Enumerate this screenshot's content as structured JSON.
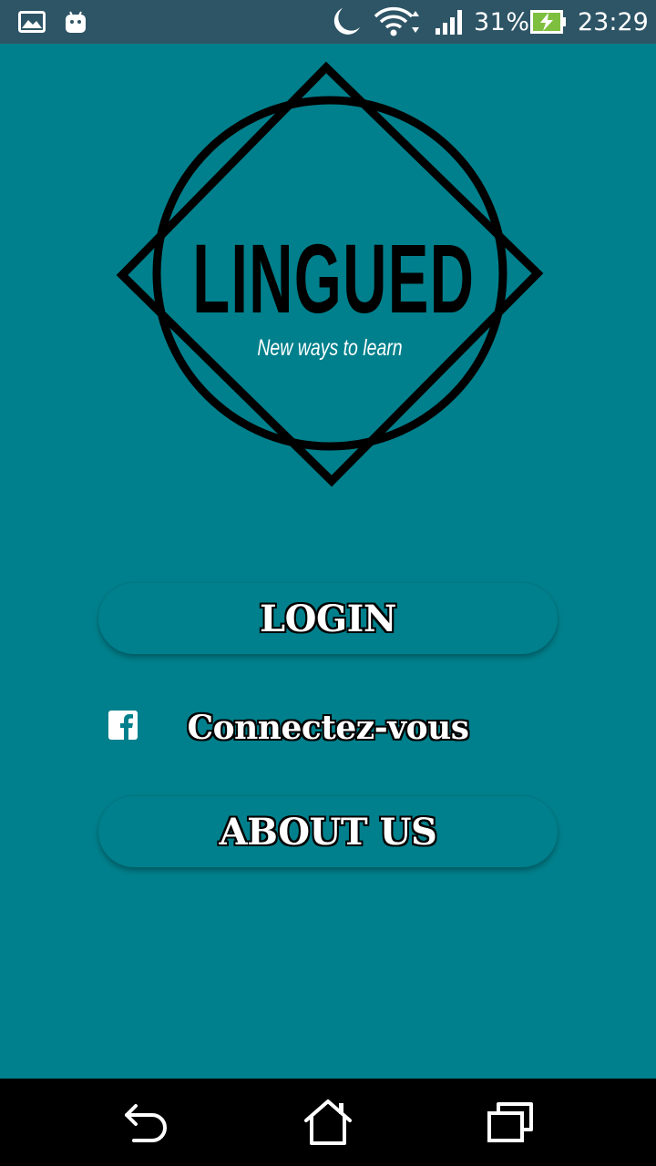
{
  "status_bar": {
    "battery_percent": "31%",
    "clock": "23:29",
    "icons": [
      "gallery-icon",
      "android-icon",
      "moon-icon",
      "wifi-icon",
      "signal-icon",
      "battery-charging-icon"
    ]
  },
  "logo": {
    "title": "LINGUED",
    "tagline": "New ways to learn"
  },
  "buttons": {
    "login_label": "LOGIN",
    "facebook_label": "Connectez-vous",
    "about_label": "ABOUT US"
  },
  "nav_bar": {
    "icons": [
      "back-icon",
      "home-icon",
      "recents-icon"
    ]
  },
  "colors": {
    "background": "#00808c",
    "status_bar": "#2e5566",
    "nav_bar": "#000000",
    "text": "#ffffff",
    "outline": "#000000"
  }
}
